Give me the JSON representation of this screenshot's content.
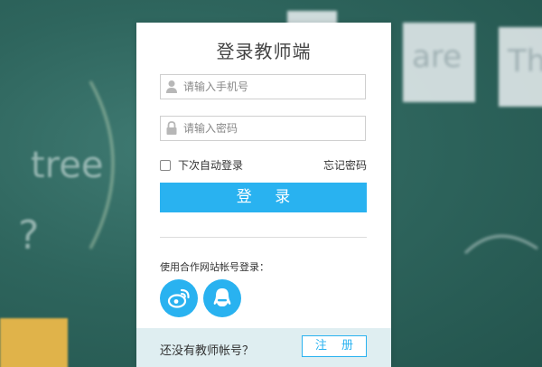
{
  "background": {
    "card_texts": [
      "are",
      "Th"
    ],
    "chalk_texts": [
      "tree",
      "?"
    ]
  },
  "login": {
    "title": "登录教师端",
    "phone_placeholder": "请输入手机号",
    "password_placeholder": "请输入密码",
    "remember_label": "下次自动登录",
    "forgot_label": "忘记密码",
    "submit_label": "登 录",
    "partner_label": "使用合作网站帐号登录：",
    "no_account_label": "还没有教师帐号？",
    "register_label": "注 册"
  },
  "icons": {
    "phone_field": "user-icon",
    "password_field": "lock-icon",
    "social": [
      "weibo-icon",
      "qq-icon"
    ]
  },
  "colors": {
    "accent": "#29b2f0",
    "bottom_bar": "#dfeef1",
    "background": "#2e655d"
  }
}
